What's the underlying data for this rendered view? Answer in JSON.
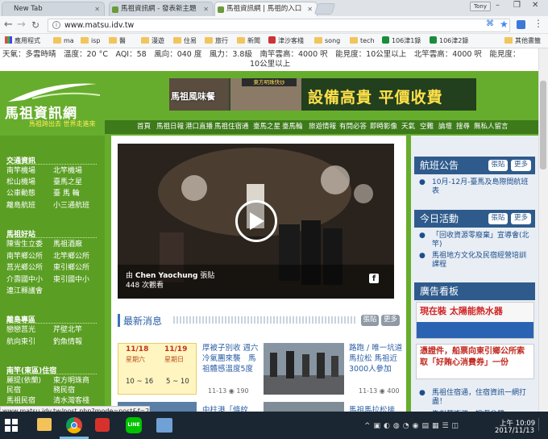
{
  "browser": {
    "tabs": [
      {
        "label": "New Tab"
      },
      {
        "label": "馬祖資訊網 - 發表新主題"
      },
      {
        "label": "馬祖資訊網 | 馬祖的入口"
      }
    ],
    "profile": "Tony",
    "url": "www.matsu.idv.tw",
    "bookmarks": [
      "應用程式",
      "ma",
      "isp",
      "醫",
      "漫遊",
      "住易",
      "旅行",
      "新聞",
      "津沙客棧",
      "song",
      "tech",
      "106津1錄",
      "106津2錄",
      "其他書籤"
    ]
  },
  "ticker": {
    "line1": "天氣：多雲時晴　溫度：20 °C　AQI：58　風向：040 度　風力：3.8級　南竿雲高：4000 呎　能見度：10公里以上　北竿雲高：4000 呎　能見度：",
    "line2": "10公里以上"
  },
  "site": {
    "logo_text": "馬祖資訊網",
    "logo_slogan": "馬祖跨出去 世界走進來",
    "banner_left": "馬祖風味餐",
    "banner_sign": "東方明珠快炒",
    "banner_right": "設備高貴 平價收費",
    "nav": [
      "首頁",
      "馬祖日報",
      "港口直播",
      "馬祖住宿通",
      "臺馬之星",
      "臺馬輪",
      "旅遊情報",
      "有問必答",
      "即時影像",
      "天氣",
      "空難",
      "論壇",
      "搜尋",
      "無私人留言"
    ]
  },
  "sidebar": {
    "sections": [
      {
        "title": "交通資訊",
        "links": [
          [
            "南竿機場",
            "北竿機場"
          ],
          [
            "松山機場",
            "臺馬之星"
          ],
          [
            "公車動態",
            "臺 馬 輪"
          ],
          [
            "離島航班",
            "小三通航班"
          ]
        ]
      },
      {
        "title": "馬祖好站",
        "links": [
          [
            "陳雪生立委",
            "馬祖酒廠"
          ],
          [
            "南竿鄉公所",
            "北竿鄉公所"
          ],
          [
            "莒光鄉公所",
            "東引鄉公所"
          ],
          [
            "介壽國中小",
            "東引國中小"
          ],
          [
            "連江縣議會",
            ""
          ]
        ]
      },
      {
        "title": "離島專區",
        "links": [
          [
            "戀戀莒光",
            "芹壁北竿"
          ],
          [
            "航向東引",
            "釣魚情報"
          ]
        ]
      },
      {
        "title": "南竿(東區)住宿",
        "links": [
          [
            "麗提(依蘭)",
            "東方明珠商"
          ],
          [
            "民宿",
            "務民宿"
          ],
          [
            "馬祖民宿",
            "清水灣客棧"
          ]
        ]
      }
    ]
  },
  "video": {
    "by": "由",
    "author": "Chen Yaochung",
    "suffix": "張貼",
    "views": "448 次觀看"
  },
  "news": {
    "title": "最新消息",
    "btn_post": "張貼",
    "btn_more": "更多",
    "calendar": {
      "d1": "11/18",
      "w1": "星期六",
      "d2": "11/19",
      "w2": "星期日",
      "t1": "10 ~ 16",
      "t2": "5 ~ 10"
    },
    "item1": "厚被子別收 週六冷氣團來襲　馬祖體感溫度5度",
    "item1_date": "11-13",
    "item1_views": "190",
    "item2": "路跑 / 唯一坑道馬拉松 馬祖近3000人參加",
    "item2_date": "11-13",
    "item2_views": "400",
    "item3": "中柱港「條紋",
    "item4": "馬祖馬拉松接"
  },
  "right": {
    "flight_title": "航班公告",
    "flight_links": [
      "10月-12月-臺馬及島際間航班表"
    ],
    "today_title": "今日活動",
    "today_links": [
      "「回收資源零廢棄」宣導會(北竿)",
      "馬祖地方文化及民宿經營培訓課程"
    ],
    "ad_title": "廣告看板",
    "ad1": "現在裝 太陽能熱水器",
    "ad2": "憑證件，船票向東引鄉公所索取「好賄心消費券」一份",
    "ad_links": [
      "馬祖住宿通，住宿資訊一網打盡！",
      "馬祖藝術週，搶渡全鷺..."
    ],
    "btn_post": "張貼",
    "btn_more": "更多"
  },
  "status_url": "www.matsu.idv.tw/post.php?mode=post&f=219",
  "taskbar": {
    "time": "上午 10:09",
    "date": "2017/11/13"
  }
}
